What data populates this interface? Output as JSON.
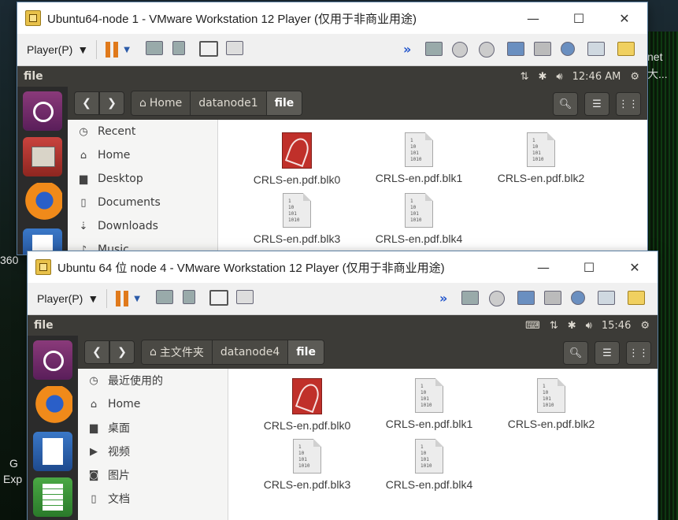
{
  "window1": {
    "title": "Ubuntu64-node 1 - VMware Workstation 12 Player (仅用于非商业用途)",
    "player_label": "Player(P)",
    "ubuntu_bar": {
      "app_name": "file",
      "time": "12:46 AM"
    },
    "breadcrumb": [
      "Home",
      "datanode1",
      "file"
    ],
    "sidebar": [
      "Recent",
      "Home",
      "Desktop",
      "Documents",
      "Downloads",
      "Music"
    ],
    "files": [
      "CRLS-en.pdf.blk0",
      "CRLS-en.pdf.blk1",
      "CRLS-en.pdf.blk2",
      "CRLS-en.pdf.blk3",
      "CRLS-en.pdf.blk4"
    ]
  },
  "window2": {
    "title": "Ubuntu 64 位 node 4 - VMware Workstation 12 Player (仅用于非商业用途)",
    "player_label": "Player(P)",
    "ubuntu_bar": {
      "app_name": "file",
      "time": "15:46"
    },
    "breadcrumb": [
      "主文件夹",
      "datanode4",
      "file"
    ],
    "sidebar": [
      "最近使用的",
      "Home",
      "桌面",
      "视频",
      "图片",
      "文档"
    ],
    "files": [
      "CRLS-en.pdf.blk0",
      "CRLS-en.pdf.blk1",
      "CRLS-en.pdf.blk2",
      "CRLS-en.pdf.blk3",
      "CRLS-en.pdf.blk4"
    ]
  },
  "desktop_text": [
    "net",
    "大...",
    "360",
    "G",
    "Exp"
  ],
  "icons": {
    "binary_label": "1\n10\n101\n1010"
  },
  "colors": {
    "ubuntu_bar": "#3c3b37",
    "pause": "#e07a1c"
  }
}
